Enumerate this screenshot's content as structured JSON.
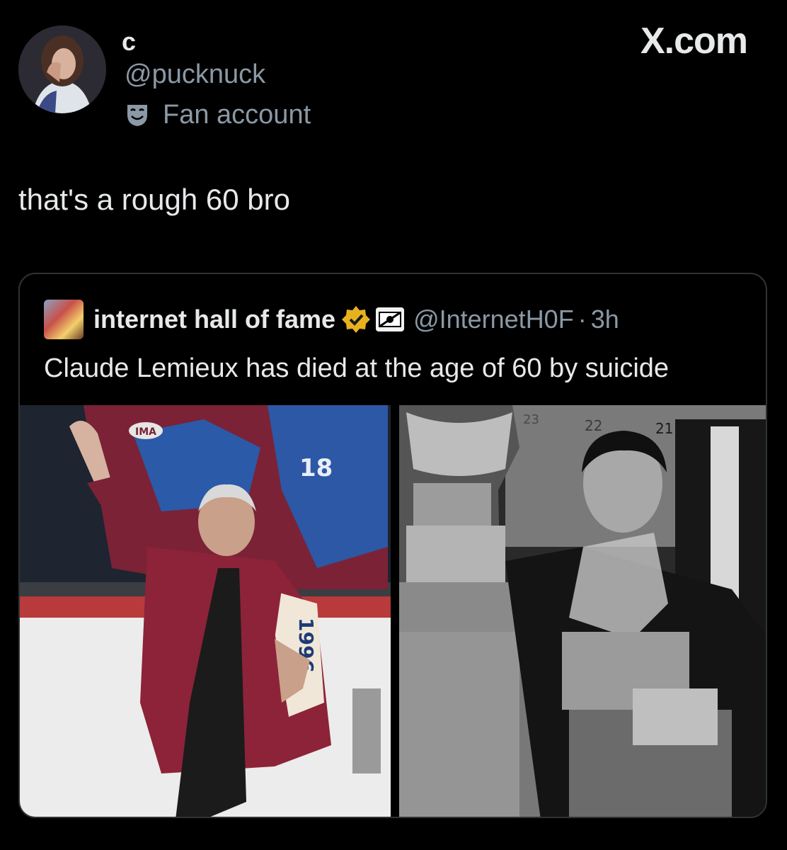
{
  "header": {
    "display_name": "c",
    "handle": "@pucknuck",
    "account_label": "Fan account",
    "brand": "X.com"
  },
  "tweet": {
    "text": "that's a rough 60 bro"
  },
  "quote": {
    "name": "internet hall of fame",
    "handle": "@InternetH0F",
    "separator": "·",
    "time": "3h",
    "text": "Claude Lemieux has died at the age of 60 by suicide",
    "verified_color": "#e8b21f"
  },
  "media": {
    "left_photo": {
      "jersey_number": "18",
      "patch_text": "IMA",
      "sleeve_text": "1996"
    },
    "right_photo": {
      "stall_numbers": [
        "22",
        "21",
        "23"
      ]
    }
  },
  "icons": [
    "user-avatar-icon",
    "mask-icon",
    "x-logo",
    "verified-icon",
    "affiliation-icon"
  ]
}
